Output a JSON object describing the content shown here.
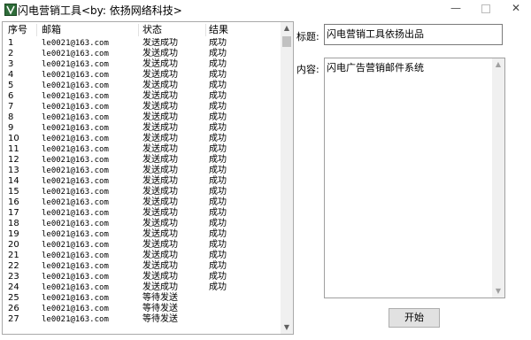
{
  "window": {
    "title": "闪电营销工具<by: 依扬网络科技>",
    "minimize_glyph": "—",
    "close_glyph": "✕",
    "icon": "app-logo-icon"
  },
  "list": {
    "headers": [
      "序号",
      "邮箱",
      "状态",
      "结果"
    ],
    "rows": [
      [
        "1",
        "le0021@163.com",
        "发送成功",
        "成功"
      ],
      [
        "2",
        "le0021@163.com",
        "发送成功",
        "成功"
      ],
      [
        "3",
        "le0021@163.com",
        "发送成功",
        "成功"
      ],
      [
        "4",
        "le0021@163.com",
        "发送成功",
        "成功"
      ],
      [
        "5",
        "le0021@163.com",
        "发送成功",
        "成功"
      ],
      [
        "6",
        "le0021@163.com",
        "发送成功",
        "成功"
      ],
      [
        "7",
        "le0021@163.com",
        "发送成功",
        "成功"
      ],
      [
        "8",
        "le0021@163.com",
        "发送成功",
        "成功"
      ],
      [
        "9",
        "le0021@163.com",
        "发送成功",
        "成功"
      ],
      [
        "10",
        "le0021@163.com",
        "发送成功",
        "成功"
      ],
      [
        "11",
        "le0021@163.com",
        "发送成功",
        "成功"
      ],
      [
        "12",
        "le0021@163.com",
        "发送成功",
        "成功"
      ],
      [
        "13",
        "le0021@163.com",
        "发送成功",
        "成功"
      ],
      [
        "14",
        "le0021@163.com",
        "发送成功",
        "成功"
      ],
      [
        "15",
        "le0021@163.com",
        "发送成功",
        "成功"
      ],
      [
        "16",
        "le0021@163.com",
        "发送成功",
        "成功"
      ],
      [
        "17",
        "le0021@163.com",
        "发送成功",
        "成功"
      ],
      [
        "18",
        "le0021@163.com",
        "发送成功",
        "成功"
      ],
      [
        "19",
        "le0021@163.com",
        "发送成功",
        "成功"
      ],
      [
        "20",
        "le0021@163.com",
        "发送成功",
        "成功"
      ],
      [
        "21",
        "le0021@163.com",
        "发送成功",
        "成功"
      ],
      [
        "22",
        "le0021@163.com",
        "发送成功",
        "成功"
      ],
      [
        "23",
        "le0021@163.com",
        "发送成功",
        "成功"
      ],
      [
        "24",
        "le0021@163.com",
        "发送成功",
        "成功"
      ],
      [
        "25",
        "le0021@163.com",
        "等待发送",
        ""
      ],
      [
        "26",
        "le0021@163.com",
        "等待发送",
        ""
      ],
      [
        "27",
        "le0021@163.com",
        "等待发送",
        ""
      ]
    ]
  },
  "form": {
    "title_label": "标题:",
    "title_value": "闪电营销工具依扬出品",
    "content_label": "内容:",
    "content_value": "闪电广告营销邮件系统",
    "start_button": "开始"
  },
  "colors": {
    "accent_icon": "#2f6d3a",
    "border": "#a9a9a9",
    "button_bg": "#e1e1e1"
  }
}
